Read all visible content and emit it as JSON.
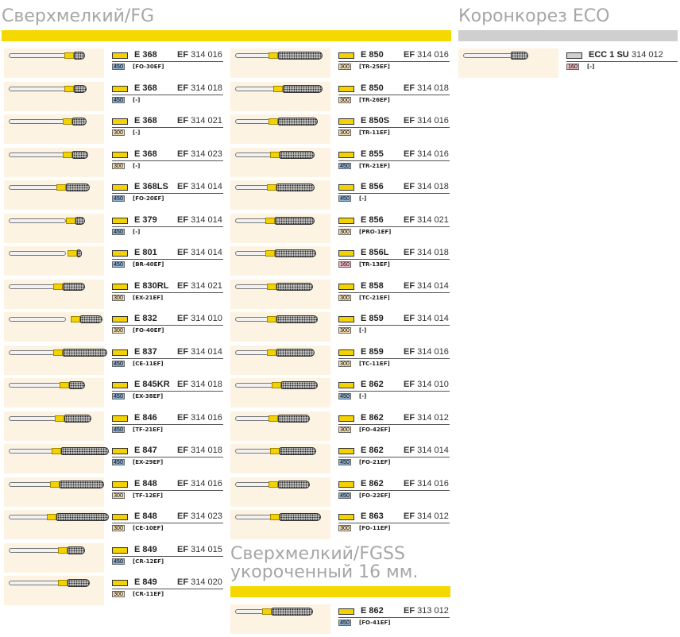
{
  "headings": {
    "fg": "Сверхмелкий/FG",
    "eco": "Коронкорез ECO",
    "fgss1": "Сверхмелкий/FGSS",
    "fgss2": "укороченный 16 мм."
  },
  "colors": {
    "yellow": "#f5d800",
    "gray": "#cfcfcf",
    "grit450": "#8fb3d6",
    "grit300": "#f6dfb5",
    "grit160": "#f0b8c0"
  },
  "col1": [
    {
      "code": "E 368",
      "ef": "EF",
      "num": "314 016",
      "grit": "450",
      "iso": "[FO-30EF]"
    },
    {
      "code": "E 368",
      "ef": "EF",
      "num": "314 018",
      "grit": "450",
      "iso": "[-]"
    },
    {
      "code": "E 368",
      "ef": "EF",
      "num": "314 021",
      "grit": "300",
      "iso": "[-]"
    },
    {
      "code": "E 368",
      "ef": "EF",
      "num": "314 023",
      "grit": "300",
      "iso": "[-]"
    },
    {
      "code": "E 368LS",
      "ef": "EF",
      "num": "314 014",
      "grit": "450",
      "iso": "[FO-20EF]"
    },
    {
      "code": "E 379",
      "ef": "EF",
      "num": "314 014",
      "grit": "450",
      "iso": "[-]"
    },
    {
      "code": "E 801",
      "ef": "EF",
      "num": "314 014",
      "grit": "450",
      "iso": "[BR-40EF]"
    },
    {
      "code": "E 830RL",
      "ef": "EF",
      "num": "314 021",
      "grit": "300",
      "iso": "[EX-21EF]"
    },
    {
      "code": "E 832",
      "ef": "EF",
      "num": "314 010",
      "grit": "300",
      "iso": "[FO-40EF]"
    },
    {
      "code": "E 837",
      "ef": "EF",
      "num": "314 014",
      "grit": "450",
      "iso": "[CE-11EF]"
    },
    {
      "code": "E 845KR",
      "ef": "EF",
      "num": "314 018",
      "grit": "450",
      "iso": "[EX-38EF]"
    },
    {
      "code": "E 846",
      "ef": "EF",
      "num": "314 016",
      "grit": "450",
      "iso": "[TF-21EF]"
    },
    {
      "code": "E 847",
      "ef": "EF",
      "num": "314 018",
      "grit": "450",
      "iso": "[EX-29EF]"
    },
    {
      "code": "E 848",
      "ef": "EF",
      "num": "314 016",
      "grit": "300",
      "iso": "[TF-12EF]"
    },
    {
      "code": "E 848",
      "ef": "EF",
      "num": "314 023",
      "grit": "300",
      "iso": "[CE-10EF]"
    },
    {
      "code": "E 849",
      "ef": "EF",
      "num": "314 015",
      "grit": "450",
      "iso": "[CR-12EF]"
    },
    {
      "code": "E 849",
      "ef": "EF",
      "num": "314 020",
      "grit": "300",
      "iso": "[CR-11EF]"
    }
  ],
  "col2": [
    {
      "code": "E 850",
      "ef": "EF",
      "num": "314 016",
      "grit": "300",
      "iso": "[TR-25EF]"
    },
    {
      "code": "E 850",
      "ef": "EF",
      "num": "314 018",
      "grit": "300",
      "iso": "[TR-26EF]"
    },
    {
      "code": "E 850S",
      "ef": "EF",
      "num": "314 016",
      "grit": "300",
      "iso": "[TR-11EF]"
    },
    {
      "code": "E 855",
      "ef": "EF",
      "num": "314 016",
      "grit": "450",
      "iso": "[TR-21EF]"
    },
    {
      "code": "E 856",
      "ef": "EF",
      "num": "314 018",
      "grit": "450",
      "iso": "[-]"
    },
    {
      "code": "E 856",
      "ef": "EF",
      "num": "314 021",
      "grit": "300",
      "iso": "[PRO-1EF]"
    },
    {
      "code": "E 856L",
      "ef": "EF",
      "num": "314 018",
      "grit": "160",
      "iso": "[TR-13EF]"
    },
    {
      "code": "E 858",
      "ef": "EF",
      "num": "314 014",
      "grit": "300",
      "iso": "[TC-21EF]"
    },
    {
      "code": "E 859",
      "ef": "EF",
      "num": "314 014",
      "grit": "300",
      "iso": "[-]"
    },
    {
      "code": "E 859",
      "ef": "EF",
      "num": "314 016",
      "grit": "300",
      "iso": "[TC-11EF]"
    },
    {
      "code": "E 862",
      "ef": "EF",
      "num": "314 010",
      "grit": "450",
      "iso": "[-]"
    },
    {
      "code": "E 862",
      "ef": "EF",
      "num": "314 012",
      "grit": "300",
      "iso": "[FO-42EF]"
    },
    {
      "code": "E 862",
      "ef": "EF",
      "num": "314 014",
      "grit": "450",
      "iso": "[FO-21EF]"
    },
    {
      "code": "E 862",
      "ef": "EF",
      "num": "314 016",
      "grit": "450",
      "iso": "[FO-22EF]"
    },
    {
      "code": "E 863",
      "ef": "EF",
      "num": "314 012",
      "grit": "300",
      "iso": "[FO-11EF]"
    }
  ],
  "fgss": [
    {
      "code": "E 862",
      "ef": "EF",
      "num": "313 012",
      "grit": "450",
      "iso": "[FO-41EF]"
    }
  ],
  "eco": [
    {
      "code": "ECC 1 SU",
      "ef": "",
      "num": "314 012",
      "grit": "160",
      "iso": "[-]"
    }
  ]
}
